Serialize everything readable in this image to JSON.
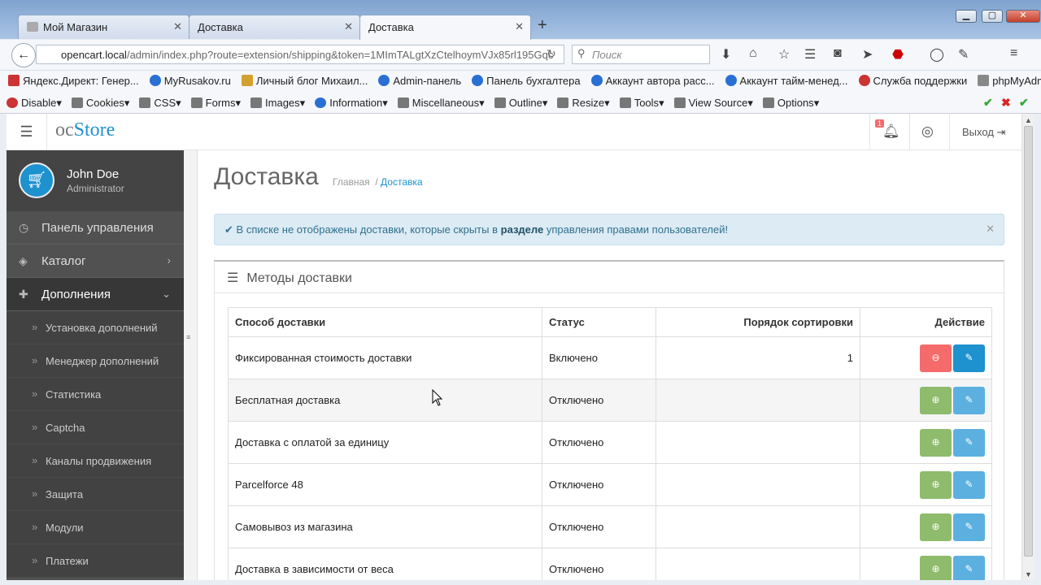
{
  "browser": {
    "tabs": [
      {
        "title": "Мой Магазин"
      },
      {
        "title": "Доставка"
      },
      {
        "title": "Доставка"
      }
    ],
    "url_host": "opencart.local",
    "url_path": "/admin/index.php?route=extension/shipping&token=1MImTALgtXzCtelhoymVJx85rl195Gqc",
    "search_placeholder": "Поиск",
    "bookmarks": [
      "Яндекс.Директ: Генер...",
      "MyRusakov.ru",
      "Личный блог Михаил...",
      "Admin-панель",
      "Панель бухгалтера",
      "Аккаунт автора расс...",
      "Аккаунт тайм-менед...",
      "Служба поддержки",
      "phpMyAdmin"
    ],
    "devtools": [
      "Disable",
      "Cookies",
      "CSS",
      "Forms",
      "Images",
      "Information",
      "Miscellaneous",
      "Outline",
      "Resize",
      "Tools",
      "View Source",
      "Options"
    ]
  },
  "header": {
    "logo_oc": "oc",
    "logo_store": "Store",
    "notification_count": "1",
    "logout": "Выход"
  },
  "sidebar": {
    "user_name": "John Doe",
    "user_role": "Administrator",
    "items": [
      {
        "label": "Панель управления"
      },
      {
        "label": "Каталог"
      },
      {
        "label": "Дополнения"
      }
    ],
    "subitems": [
      "Установка дополнений",
      "Менеджер дополнений",
      "Статистика",
      "Captcha",
      "Каналы продвижения",
      "Защита",
      "Модули",
      "Платежи"
    ]
  },
  "main": {
    "title": "Доставка",
    "breadcrumb_home": "Главная",
    "breadcrumb_current": "Доставка",
    "alert_before": "В списке не отображены доставки, которые скрыты в",
    "alert_bold": "разделе",
    "alert_after": "управления правами пользователей!",
    "panel_title": "Методы доставки",
    "columns": [
      "Способ доставки",
      "Статус",
      "Порядок сортировки",
      "Действие"
    ],
    "rows": [
      {
        "name": "Фиксированная стоимость доставки",
        "status": "Включено",
        "sort": "1"
      },
      {
        "name": "Бесплатная доставка",
        "status": "Отключено",
        "sort": ""
      },
      {
        "name": "Доставка с оплатой за единицу",
        "status": "Отключено",
        "sort": ""
      },
      {
        "name": "Parcelforce 48",
        "status": "Отключено",
        "sort": ""
      },
      {
        "name": "Самовывоз из магазина",
        "status": "Отключено",
        "sort": ""
      },
      {
        "name": "Доставка в зависимости от веса",
        "status": "Отключено",
        "sort": ""
      }
    ]
  }
}
